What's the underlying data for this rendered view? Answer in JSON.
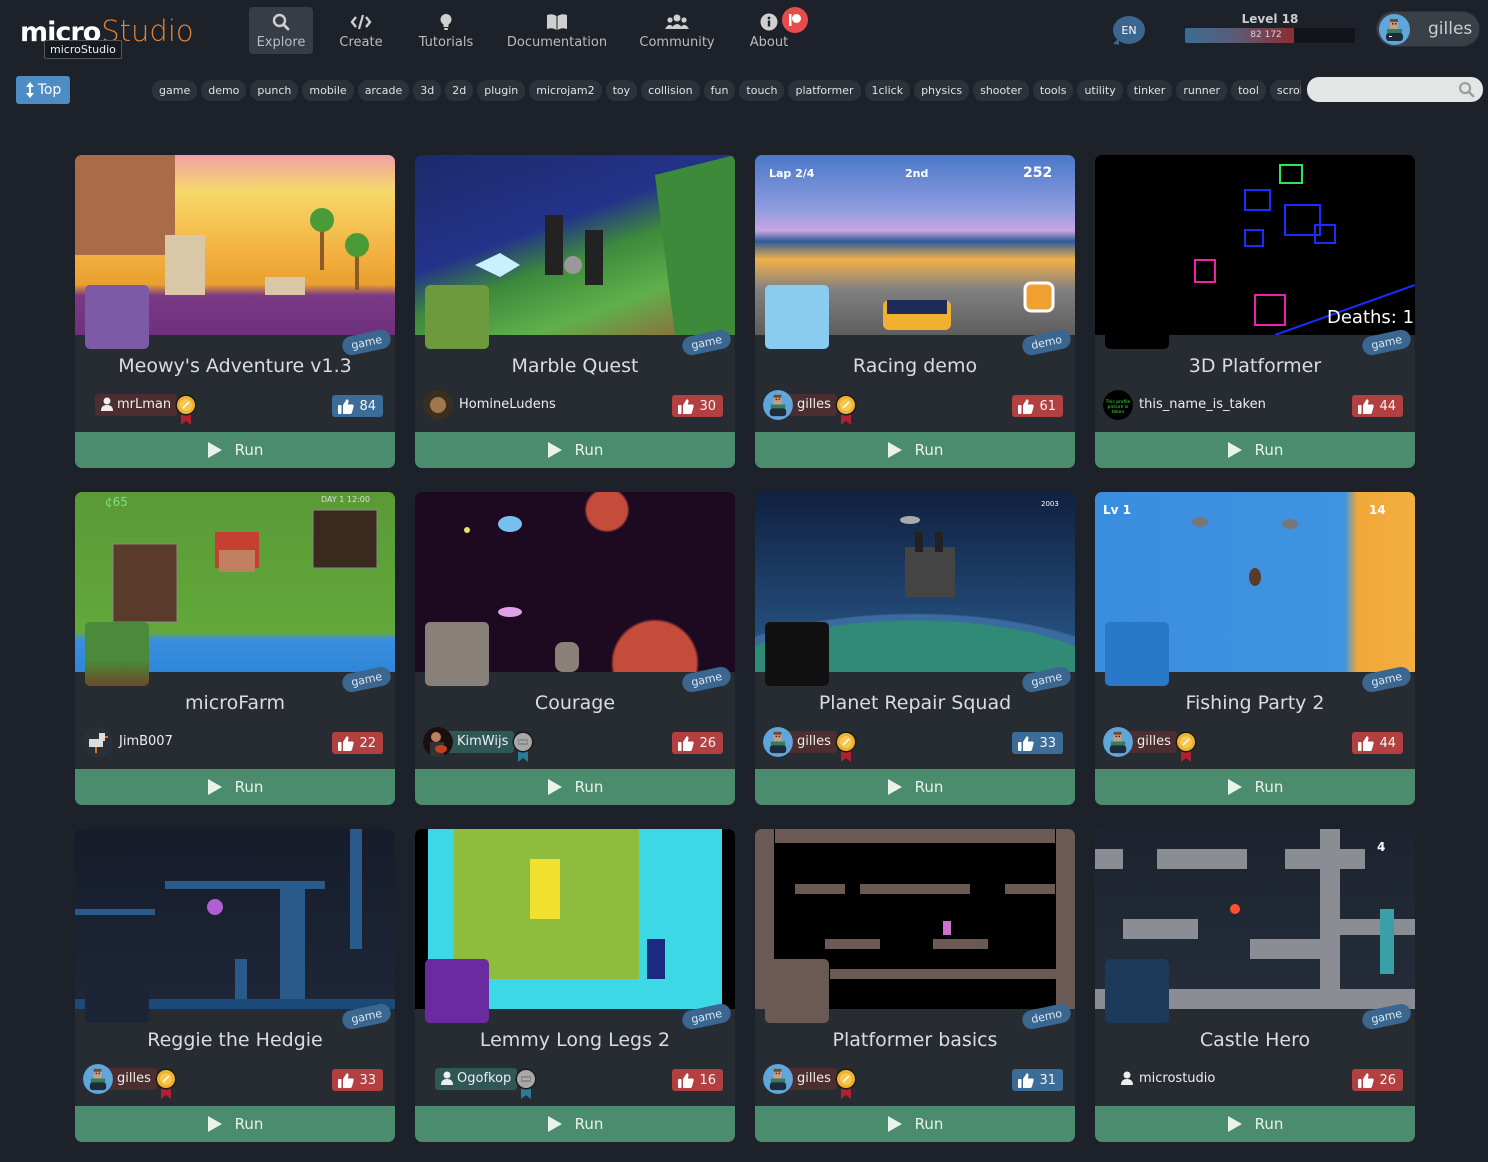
{
  "header": {
    "logo_micro": "micro",
    "logo_studio": "Studio",
    "logo_tooltip": "microStudio",
    "nav": [
      {
        "id": "explore",
        "label": "Explore",
        "icon": "search-icon",
        "active": true
      },
      {
        "id": "create",
        "label": "Create",
        "icon": "code-icon",
        "active": false
      },
      {
        "id": "tutorials",
        "label": "Tutorials",
        "icon": "lightbulb-icon",
        "active": false
      },
      {
        "id": "documentation",
        "label": "Documentation",
        "icon": "book-icon",
        "active": false
      },
      {
        "id": "community",
        "label": "Community",
        "icon": "users-icon",
        "active": false
      },
      {
        "id": "about",
        "label": "About",
        "icon": "info-icon",
        "active": false
      }
    ],
    "language": "EN",
    "level": {
      "label": "Level 18",
      "xp": "82 172",
      "progress_fraction": 0.64
    },
    "user": {
      "name": "gilles"
    }
  },
  "toolbar": {
    "top_label": "Top",
    "tags": [
      "game",
      "demo",
      "punch",
      "mobile",
      "arcade",
      "3d",
      "2d",
      "plugin",
      "microjam2",
      "toy",
      "collision",
      "fun",
      "touch",
      "platformer",
      "1click",
      "physics",
      "shooter",
      "tools",
      "utility",
      "tinker",
      "runner",
      "tool",
      "scrolling"
    ],
    "search_placeholder": ""
  },
  "colors": {
    "background": "#1d222a",
    "card": "#272c33",
    "run_button": "#4c8c6e",
    "liked": "#3b6d98",
    "not_liked": "#b34040",
    "type_badge": "#3a6690",
    "logo_accent": "#e58530"
  },
  "projects": [
    {
      "title": "Meowy's Adventure v1.3",
      "type": "game",
      "author": "mrLman",
      "author_style": "dark-box",
      "avatar": "user-icon",
      "medal": "gold",
      "likes": "84",
      "liked": true,
      "run_label": "Run",
      "thumb": "meowy"
    },
    {
      "title": "Marble Quest",
      "type": "game",
      "author": "HomineLudens",
      "author_style": "plain",
      "avatar": "portrait",
      "medal": "",
      "likes": "30",
      "liked": false,
      "run_label": "Run",
      "thumb": "marble"
    },
    {
      "title": "Racing demo",
      "type": "demo",
      "author": "gilles",
      "author_style": "dark",
      "avatar": "gilles",
      "medal": "gold",
      "likes": "61",
      "liked": false,
      "run_label": "Run",
      "thumb": "racing"
    },
    {
      "title": "3D Platformer",
      "type": "game",
      "author": "this_name_is_taken",
      "author_style": "plain",
      "avatar": "text",
      "medal": "",
      "likes": "44",
      "liked": false,
      "run_label": "Run",
      "thumb": "platformer3d"
    },
    {
      "title": "microFarm",
      "type": "game",
      "author": "JimB007",
      "author_style": "plain",
      "avatar": "bird",
      "medal": "",
      "likes": "22",
      "liked": false,
      "run_label": "Run",
      "thumb": "farm"
    },
    {
      "title": "Courage",
      "type": "game",
      "author": "KimWijs",
      "author_style": "teal",
      "avatar": "guitar",
      "medal": "silver",
      "likes": "26",
      "liked": false,
      "run_label": "Run",
      "thumb": "courage"
    },
    {
      "title": "Planet Repair Squad",
      "type": "game",
      "author": "gilles",
      "author_style": "dark",
      "avatar": "gilles",
      "medal": "gold",
      "likes": "33",
      "liked": true,
      "run_label": "Run",
      "thumb": "planet"
    },
    {
      "title": "Fishing Party 2",
      "type": "game",
      "author": "gilles",
      "author_style": "dark",
      "avatar": "gilles",
      "medal": "gold",
      "likes": "44",
      "liked": false,
      "run_label": "Run",
      "thumb": "fishing"
    },
    {
      "title": "Reggie the Hedgie",
      "type": "game",
      "author": "gilles",
      "author_style": "dark",
      "avatar": "gilles",
      "medal": "gold",
      "likes": "33",
      "liked": false,
      "run_label": "Run",
      "thumb": "reggie"
    },
    {
      "title": "Lemmy Long Legs 2",
      "type": "game",
      "author": "Ogofkop",
      "author_style": "teal-box",
      "avatar": "user-icon",
      "medal": "silver",
      "likes": "16",
      "liked": false,
      "run_label": "Run",
      "thumb": "lemmy"
    },
    {
      "title": "Platformer basics",
      "type": "demo",
      "author": "gilles",
      "author_style": "dark",
      "avatar": "gilles",
      "medal": "gold",
      "likes": "31",
      "liked": true,
      "run_label": "Run",
      "thumb": "basics"
    },
    {
      "title": "Castle Hero",
      "type": "game",
      "author": "microstudio",
      "author_style": "plain-icon",
      "avatar": "user-icon",
      "medal": "",
      "likes": "26",
      "liked": false,
      "run_label": "Run",
      "thumb": "castle"
    }
  ]
}
